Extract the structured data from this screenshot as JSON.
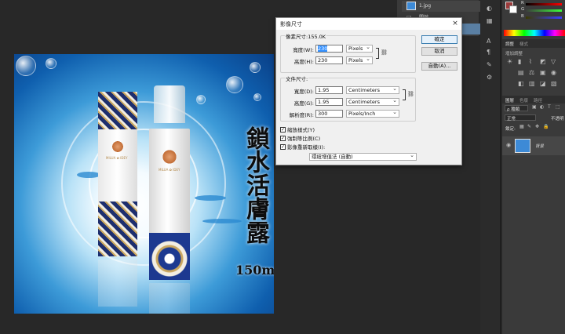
{
  "history": {
    "file_item": "1.jpg",
    "open_item": "開啟"
  },
  "artwork": {
    "title_vertical": "鎖水活膚露",
    "volume": "150ml",
    "brand_box": "MILUA ✿ IDEY",
    "brand_bottle": "MILUA ✿ IDEY"
  },
  "dialog": {
    "title": "影像尺寸",
    "close": "×",
    "pixel_dims": {
      "legend": "像素尺寸:155.0K",
      "width_label": "寬度(W):",
      "width_value": "230",
      "width_unit": "Pixels",
      "height_label": "高度(H):",
      "height_value": "230",
      "height_unit": "Pixels"
    },
    "doc_size": {
      "legend": "文件尺寸:",
      "width_label": "寬度(D):",
      "width_value": "1.95",
      "width_unit": "Centimeters",
      "height_label": "高度(G):",
      "height_value": "1.95",
      "height_unit": "Centimeters",
      "res_label": "解析度(R):",
      "res_value": "300",
      "res_unit": "Pixels/Inch"
    },
    "buttons": {
      "ok": "確定",
      "cancel": "取消",
      "auto": "自動(A)..."
    },
    "checks": {
      "scale_styles": "縮放樣式(Y)",
      "constrain": "強制等比例(C)",
      "resample": "影像重新取樣(I):"
    },
    "resample_method": "環紐增值法 (自動)"
  },
  "panels": {
    "color_r": "R",
    "color_g": "G",
    "color_b": "B",
    "adjust_tab": "調整",
    "styles_tab": "樣式",
    "add_adjust": "增加調整",
    "layers_tab": "圖層",
    "channels_tab": "色版",
    "paths_tab": "路徑",
    "kind": "ρ 種類",
    "blend": "正常",
    "opacity": "不透明",
    "lock": "鎖定:",
    "layer_name": "背景"
  }
}
